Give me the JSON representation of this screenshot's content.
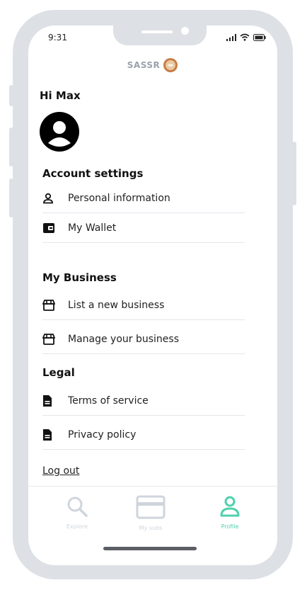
{
  "status_bar": {
    "time": "9:31"
  },
  "header": {
    "brand": "SASSR"
  },
  "profile": {
    "greeting": "Hi Max"
  },
  "sections": [
    {
      "title": "Account settings",
      "items": [
        {
          "label": "Personal information",
          "icon": "person-icon"
        },
        {
          "label": "My Wallet",
          "icon": "wallet-icon"
        }
      ]
    },
    {
      "title": "My Business",
      "items": [
        {
          "label": "List a new business",
          "icon": "storefront-icon"
        },
        {
          "label": "Manage your business",
          "icon": "storefront-icon"
        }
      ]
    },
    {
      "title": "Legal",
      "items": [
        {
          "label": "Terms of service",
          "icon": "document-icon"
        },
        {
          "label": "Privacy policy",
          "icon": "document-icon"
        }
      ]
    }
  ],
  "logout": "Log out",
  "tabbar": {
    "tabs": [
      {
        "label": "Explore",
        "icon": "search-icon",
        "active": false
      },
      {
        "label": "My subs",
        "icon": "card-icon",
        "active": false
      },
      {
        "label": "Profile",
        "icon": "person-icon",
        "active": true
      }
    ]
  },
  "colors": {
    "accent": "#4fd1ad",
    "inactive": "#cfd5dc",
    "frame": "#dde0e5"
  }
}
